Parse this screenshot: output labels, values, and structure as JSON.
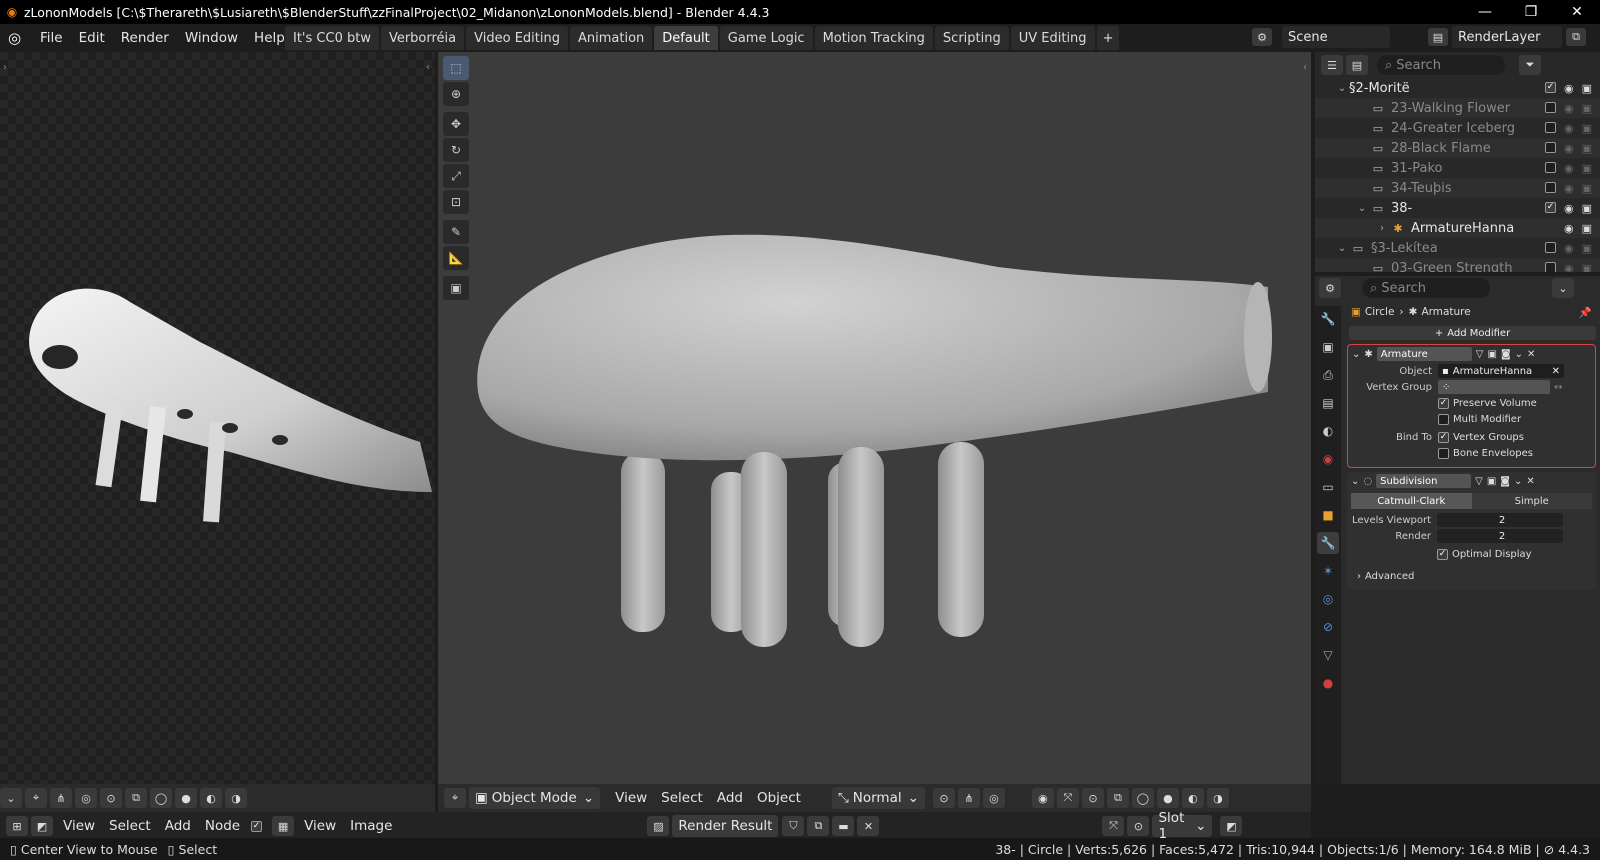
{
  "window": {
    "title": "zLononModels [C:\\$Therareth\\$Lusiareth\\$BlenderStuff\\zzFinalProject\\02_Midanon\\zLononModels.blend] - Blender 4.4.3"
  },
  "menu": [
    "File",
    "Edit",
    "Render",
    "Window",
    "Help"
  ],
  "workspaces": [
    "It's CC0 btw",
    "Verborréia",
    "Video Editing",
    "Animation",
    "Default",
    "Game Logic",
    "Motion Tracking",
    "Scripting",
    "UV Editing"
  ],
  "active_workspace": "Default",
  "scene": "Scene",
  "view_layer": "RenderLayer",
  "outliner": {
    "search_placeholder": "Search",
    "rows": [
      {
        "label": "§2-Moritë",
        "dim": false
      },
      {
        "label": "23-Walking Flower",
        "dim": true
      },
      {
        "label": "24-Greater Iceberg",
        "dim": true
      },
      {
        "label": "28-Black Flame",
        "dim": true
      },
      {
        "label": "31-Pako",
        "dim": true
      },
      {
        "label": "34-Teuþis",
        "dim": true
      },
      {
        "label": "38-",
        "dim": false
      },
      {
        "label": "ArmatureHanna",
        "dim": false
      },
      {
        "label": "§3-Lekítea",
        "dim": true
      },
      {
        "label": "03-Green Strength",
        "dim": true
      }
    ]
  },
  "properties": {
    "search_placeholder": "Search",
    "breadcrumb": [
      "Circle",
      "Armature"
    ],
    "add_modifier": "Add Modifier",
    "armature": {
      "name": "Armature",
      "object_label": "Object",
      "object_value": "ArmatureHanna",
      "vertex_group_label": "Vertex Group",
      "preserve_volume": "Preserve Volume",
      "multi_modifier": "Multi Modifier",
      "bind_to_label": "Bind To",
      "vertex_groups": "Vertex Groups",
      "bone_envelopes": "Bone Envelopes"
    },
    "subdivision": {
      "name": "Subdivision",
      "catmull": "Catmull-Clark",
      "simple": "Simple",
      "levels_viewport_label": "Levels Viewport",
      "levels_viewport": "2",
      "render_label": "Render",
      "render": "2",
      "optimal_display": "Optimal Display",
      "advanced": "Advanced"
    }
  },
  "viewport_header": {
    "mode": "Object Mode",
    "menus": [
      "View",
      "Select",
      "Add",
      "Object"
    ],
    "orientation": "Normal"
  },
  "lower_header": {
    "node_menus": [
      "View",
      "Select",
      "Add",
      "Node"
    ],
    "image_menus": [
      "View",
      "Image"
    ],
    "render_result": "Render Result",
    "slot": "Slot 1"
  },
  "status": {
    "left1": "Center View to Mouse",
    "left2": "Select",
    "right": "38- | Circle | Verts:5,626 | Faces:5,472 | Tris:10,944 | Objects:1/6 | Memory: 164.8 MiB |",
    "version": "4.4.3"
  }
}
